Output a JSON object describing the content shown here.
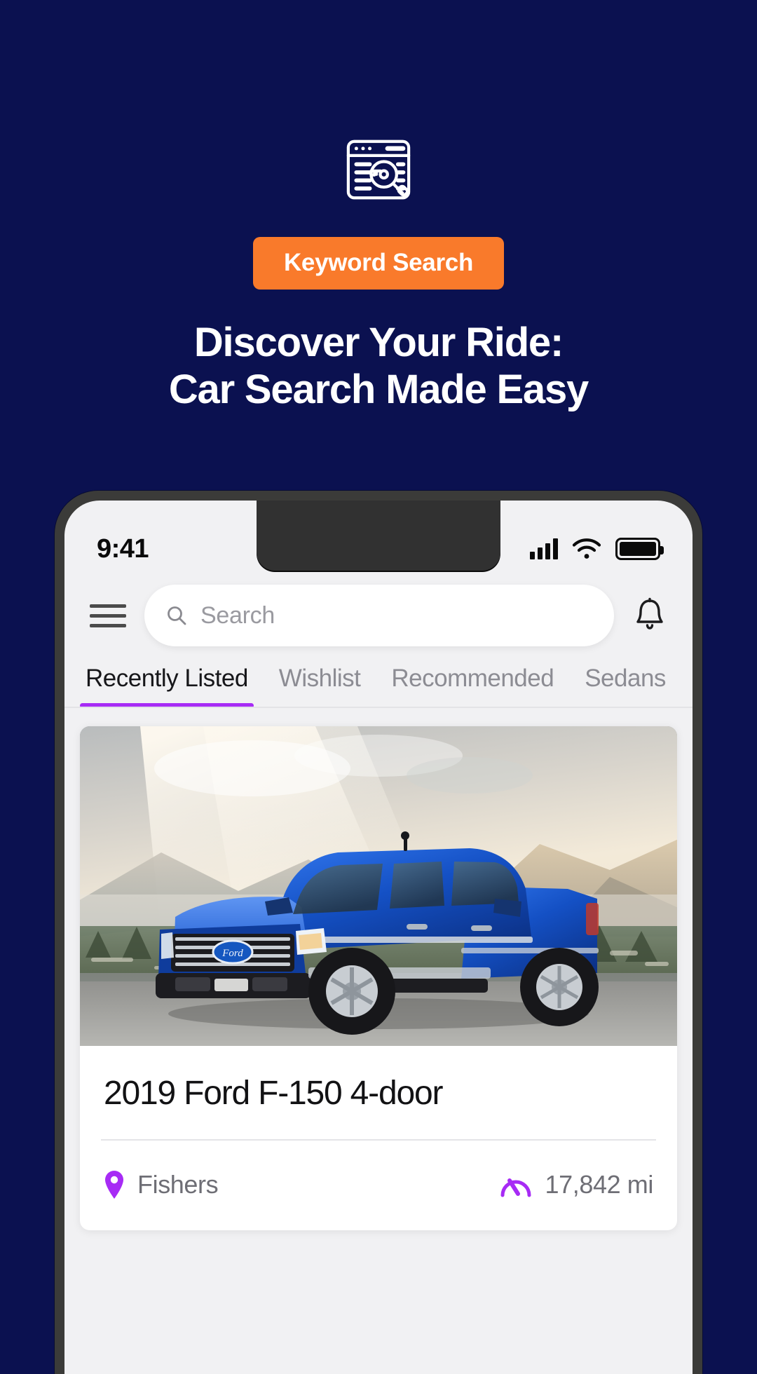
{
  "theme": {
    "background": "#0B1150",
    "badge_bg": "#F97A2B",
    "accent_purple": "#A72BF5",
    "phone_frame": "#3B3B39",
    "screen_bg": "#F1F1F3"
  },
  "hero": {
    "icon_name": "keyword-search-icon",
    "badge_label": "Keyword Search",
    "headline_line1": "Discover Your Ride:",
    "headline_line2": "Car Search Made Easy"
  },
  "phone": {
    "status_bar": {
      "time": "9:41",
      "signal_icon": "cellular-signal-icon",
      "wifi_icon": "wifi-icon",
      "battery_icon": "battery-full-icon"
    },
    "app_bar": {
      "menu_icon": "hamburger-menu-icon",
      "search_icon": "search-icon",
      "search_placeholder": "Search",
      "search_value": "",
      "notification_icon": "bell-icon"
    },
    "tabs": [
      {
        "label": "Recently Listed",
        "active": true
      },
      {
        "label": "Wishlist",
        "active": false
      },
      {
        "label": "Recommended",
        "active": false
      },
      {
        "label": "Sedans",
        "active": false
      }
    ],
    "listing": {
      "photo_alt": "blue-ford-f150-pickup-truck",
      "title": "2019 Ford F-150 4-door",
      "location_icon": "location-pin-icon",
      "location": "Fishers",
      "mileage_icon": "speedometer-icon",
      "mileage": "17,842 mi"
    }
  }
}
